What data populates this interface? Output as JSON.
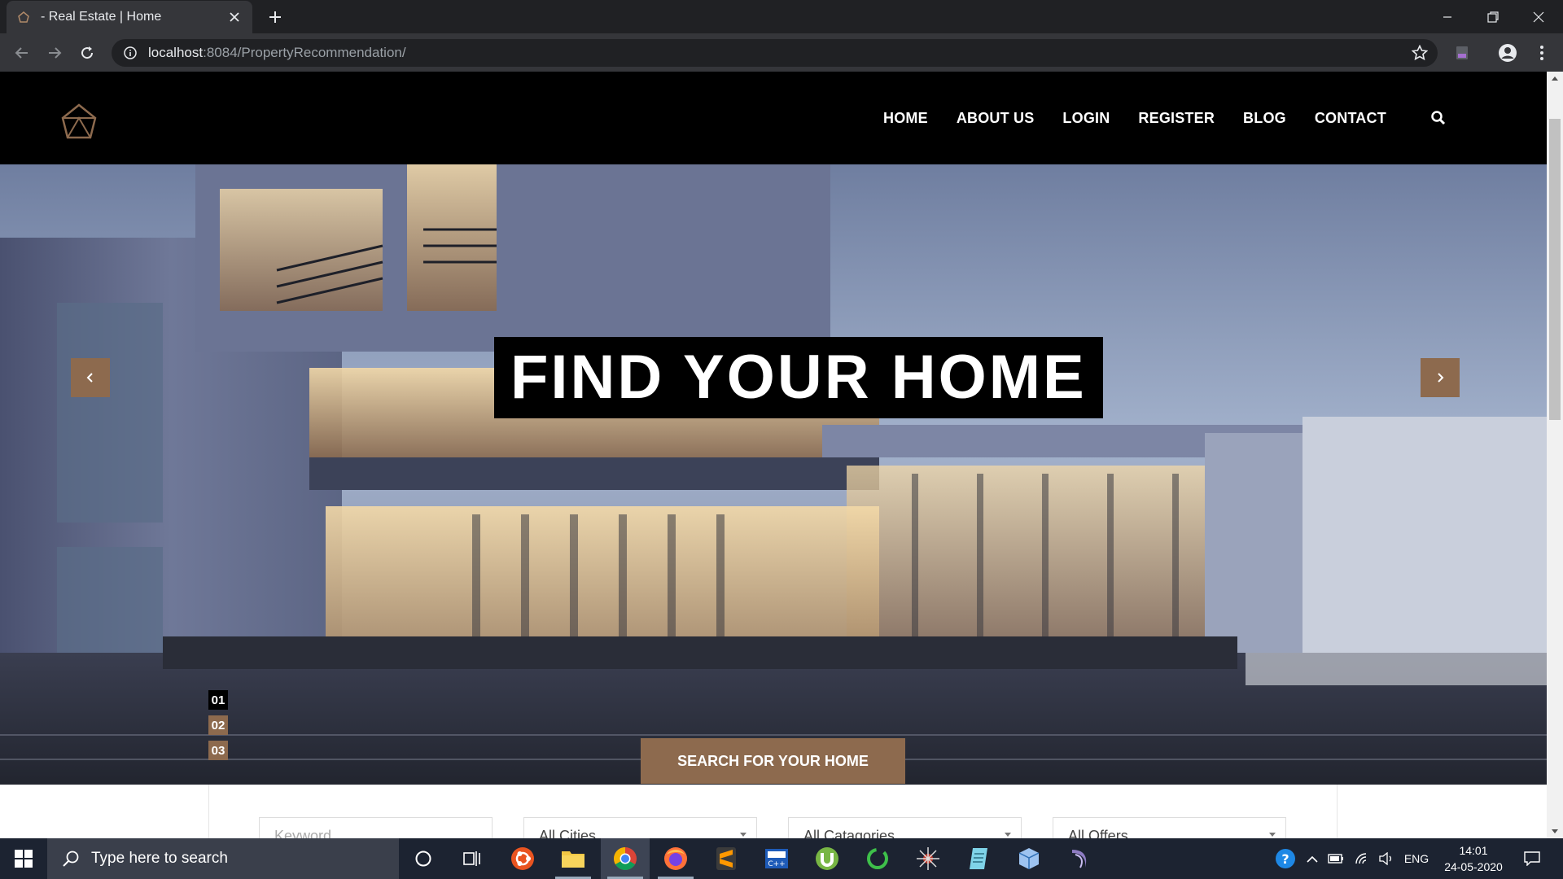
{
  "browser": {
    "tab_title": "- Real Estate | Home",
    "url_host": "localhost",
    "url_rest": ":8084/PropertyRecommendation/"
  },
  "site": {
    "nav": [
      "HOME",
      "ABOUT US",
      "LOGIN",
      "REGISTER",
      "BLOG",
      "CONTACT"
    ],
    "hero_title": "FIND YOUR HOME",
    "slides": [
      "01",
      "02",
      "03"
    ],
    "active_slide": "01",
    "cta": "SEARCH FOR YOUR HOME",
    "search": {
      "keyword_placeholder": "Keyword",
      "city": "All Cities",
      "category": "All Catagories",
      "offer": "All Offers"
    },
    "colors": {
      "accent": "#8d6a4e",
      "header_bg": "#000000"
    }
  },
  "taskbar": {
    "search_placeholder": "Type here to search",
    "lang": "ENG",
    "time": "14:01",
    "date": "24-05-2020",
    "apps": [
      "cortana-icon",
      "task-view-icon",
      "ubuntu-icon",
      "file-explorer-icon",
      "chrome-icon",
      "firefox-icon",
      "sublime-text-icon",
      "devc-icon",
      "utorrent-icon",
      "circle-app-icon",
      "spider-app-icon",
      "notepad-icon",
      "virtualbox-icon",
      "eclipse-icon"
    ]
  }
}
